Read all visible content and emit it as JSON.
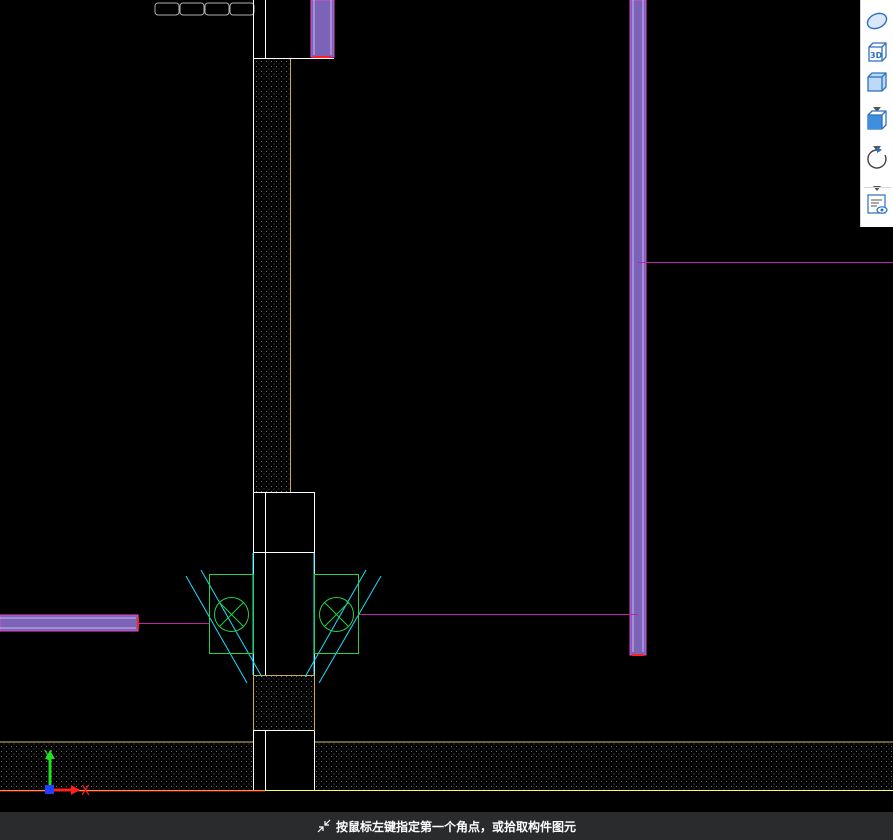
{
  "app": {
    "status_prompt": "按鼠标左键指定第一个角点，或拾取构件图元"
  },
  "axes": {
    "x_label": "X",
    "y_label": "Y"
  },
  "view_toolbar": {
    "items": [
      {
        "name": "dynamic-observe",
        "icon": "orbit-icon"
      },
      {
        "name": "3d-view",
        "icon": "3d-cube-icon",
        "label": "3D"
      },
      {
        "name": "view-cube",
        "icon": "cube-icon"
      },
      {
        "name": "view-direction",
        "icon": "cube-face-icon"
      },
      {
        "name": "rotate",
        "icon": "rotate-icon"
      },
      {
        "name": "display-settings",
        "icon": "eye-list-icon"
      }
    ]
  },
  "colors": {
    "background": "#000000",
    "wall_outline": "#ffffff",
    "insulation": "#d4a94a",
    "beam_fill": "#7b63b7",
    "beam_edge": "#e24bd2",
    "pipe": "#24d24a",
    "hatch_line": "#18e0ff",
    "axis_red": "#ff2020",
    "axis_green": "#20e020",
    "ground_line": "#ffff60"
  }
}
